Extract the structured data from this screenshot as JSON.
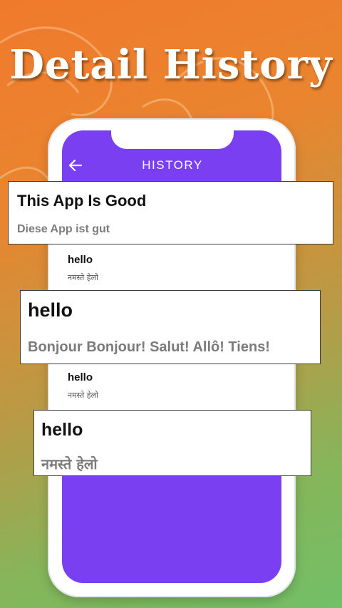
{
  "headline": "Detail History",
  "app": {
    "title": "HISTORY",
    "back_icon": "arrow-left-icon"
  },
  "colors": {
    "screen_purple": "#7a3ff0",
    "bg_orange": "#f07a2c",
    "bg_green": "#72c067"
  },
  "history": [
    {
      "word": "This App Is Good",
      "translation": "Diese App ist gut"
    },
    {
      "word": "hello",
      "translation": "नमस्ते हेलो"
    },
    {
      "word": "hello",
      "translation": "Bonjour  Bonjour! Salut! Allô! Tiens!"
    },
    {
      "word": "hello",
      "translation": "नमस्ते हेलो"
    },
    {
      "word": "hello",
      "translation": "नमस्ते  हेलो"
    }
  ]
}
